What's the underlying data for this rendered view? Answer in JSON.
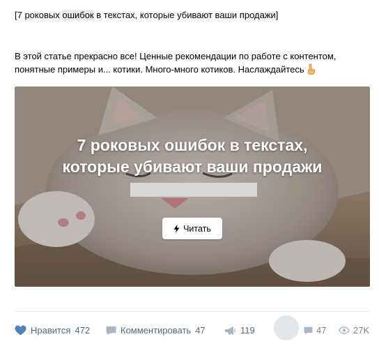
{
  "post": {
    "title_before": "[7 роковых ",
    "title_highlight": "ошибок",
    "title_after": " в текстах, которые убивают ваши продажи]",
    "description": "В этой статье прекрасно все! Ценные рекомендации по работе с контентом, понятные примеры и... котики. Много-много котиков. Наслаждайтесь",
    "emoji": "pointing-down-hand-icon"
  },
  "card": {
    "title": "7 роковых ошибок в текстах, которые убивают ваши продажи",
    "button_label": "Читать",
    "button_icon": "lightning-icon"
  },
  "actions": {
    "like_label": "Нравится",
    "like_count": "472",
    "comment_label": "Комментировать",
    "comment_count": "47",
    "share_count": "119",
    "comments_stat": "47",
    "views_stat": "27K"
  },
  "colors": {
    "accent": "#4a76a8",
    "action_text": "#55677d",
    "stat_text": "#828282",
    "divider": "#e7e8ec"
  }
}
